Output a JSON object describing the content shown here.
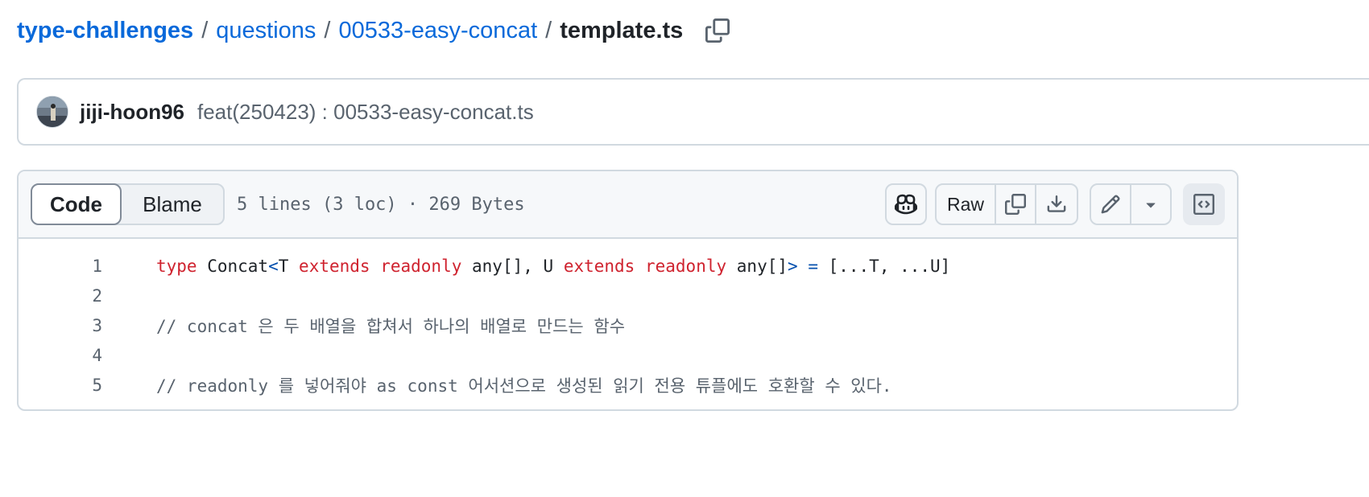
{
  "breadcrumb": {
    "repo": "type-challenges",
    "folder1": "questions",
    "folder2": "00533-easy-concat",
    "file": "template.ts",
    "separator": "/",
    "copy_icon": "copy-icon"
  },
  "commit": {
    "author": "jiji-hoon96",
    "message": "feat(250423) : 00533-easy-concat.ts"
  },
  "file_header": {
    "tabs": [
      "Code",
      "Blame"
    ],
    "active_tab": "Code",
    "meta": "5 lines (3 loc) · 269 Bytes",
    "raw_label": "Raw",
    "icons": [
      "copilot-icon",
      "copy-icon",
      "download-icon",
      "pencil-icon",
      "triangle-down-icon",
      "code-square-icon"
    ]
  },
  "code": {
    "line_numbers": [
      "1",
      "2",
      "3",
      "4",
      "5"
    ],
    "line1": {
      "t1": "type",
      "t2": " Concat",
      "t3": "<",
      "t4": "T ",
      "t5": "extends",
      "t6": " ",
      "t7": "readonly",
      "t8": " any[], U ",
      "t9": "extends",
      "t10": " ",
      "t11": "readonly",
      "t12": " any[]",
      "t13": ">",
      "t14": " ",
      "t15": "=",
      "t16": " [...T, ...U]"
    },
    "line3": "// concat 은 두 배열을 합쳐서 하나의 배열로 만드는 함수",
    "line5": "// readonly 를 넣어줘야 as const 어서션으로 생성된 읽기 전용 튜플에도 호환할 수 있다."
  },
  "colors": {
    "link": "#0969da",
    "keyword": "#cf222e",
    "operator": "#0550ae",
    "comment": "#59636e",
    "border": "#d1d9e0"
  }
}
